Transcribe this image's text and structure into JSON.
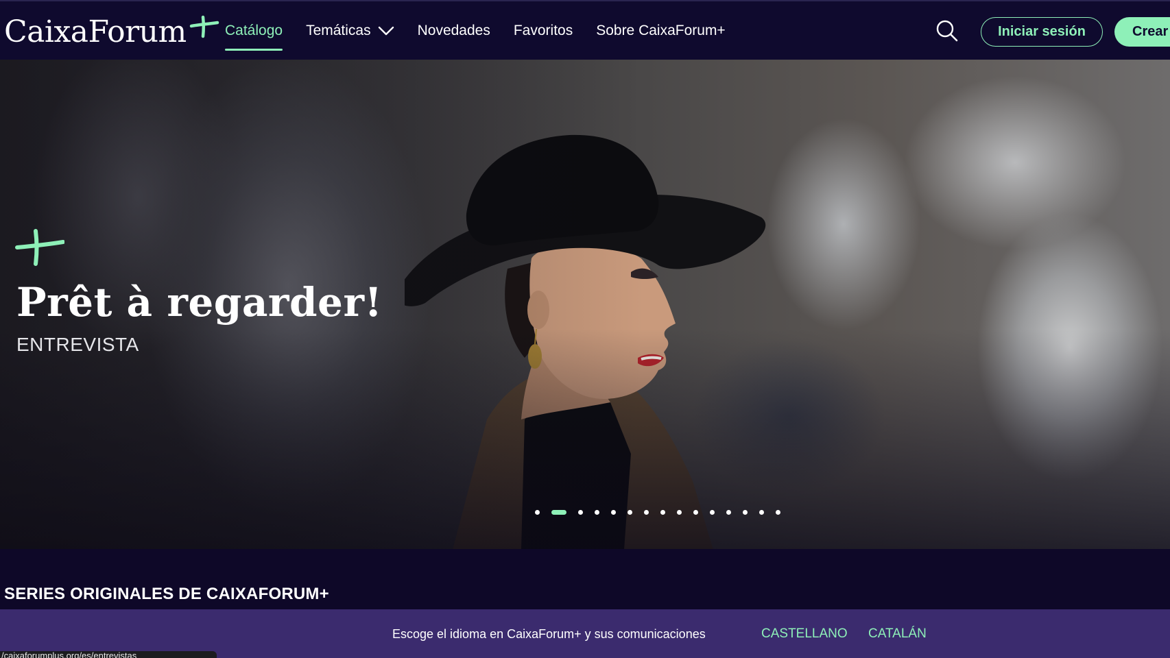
{
  "header": {
    "logo_text": "CaixaForum",
    "nav": [
      {
        "label": "Catálogo"
      },
      {
        "label": "Temáticas"
      },
      {
        "label": "Novedades"
      },
      {
        "label": "Favoritos"
      },
      {
        "label": "Sobre CaixaForum+"
      }
    ],
    "login_label": "Iniciar sesión",
    "create_label": "Crear"
  },
  "hero": {
    "title": "Prêt à regarder!",
    "subtitle": "ENTREVISTA",
    "slides_total": 15,
    "active_slide": 2
  },
  "section": {
    "title": "SERIES ORIGINALES DE CAIXAFORUM+"
  },
  "language_bar": {
    "text": "Escoge el idioma en CaixaForum+ y sus comunicaciones",
    "option_1": "CASTELLANO",
    "option_2": "CATALÁN"
  },
  "status_bar": {
    "url_text": "/caixaforumplus.org/es/entrevistas"
  },
  "colors": {
    "accent": "#8ef0b8",
    "header_bg": "#0f0a2e",
    "language_bar_bg": "#3b2b6e"
  },
  "icons": [
    "plus-logo-icon",
    "chevron-down-icon",
    "search-icon"
  ]
}
